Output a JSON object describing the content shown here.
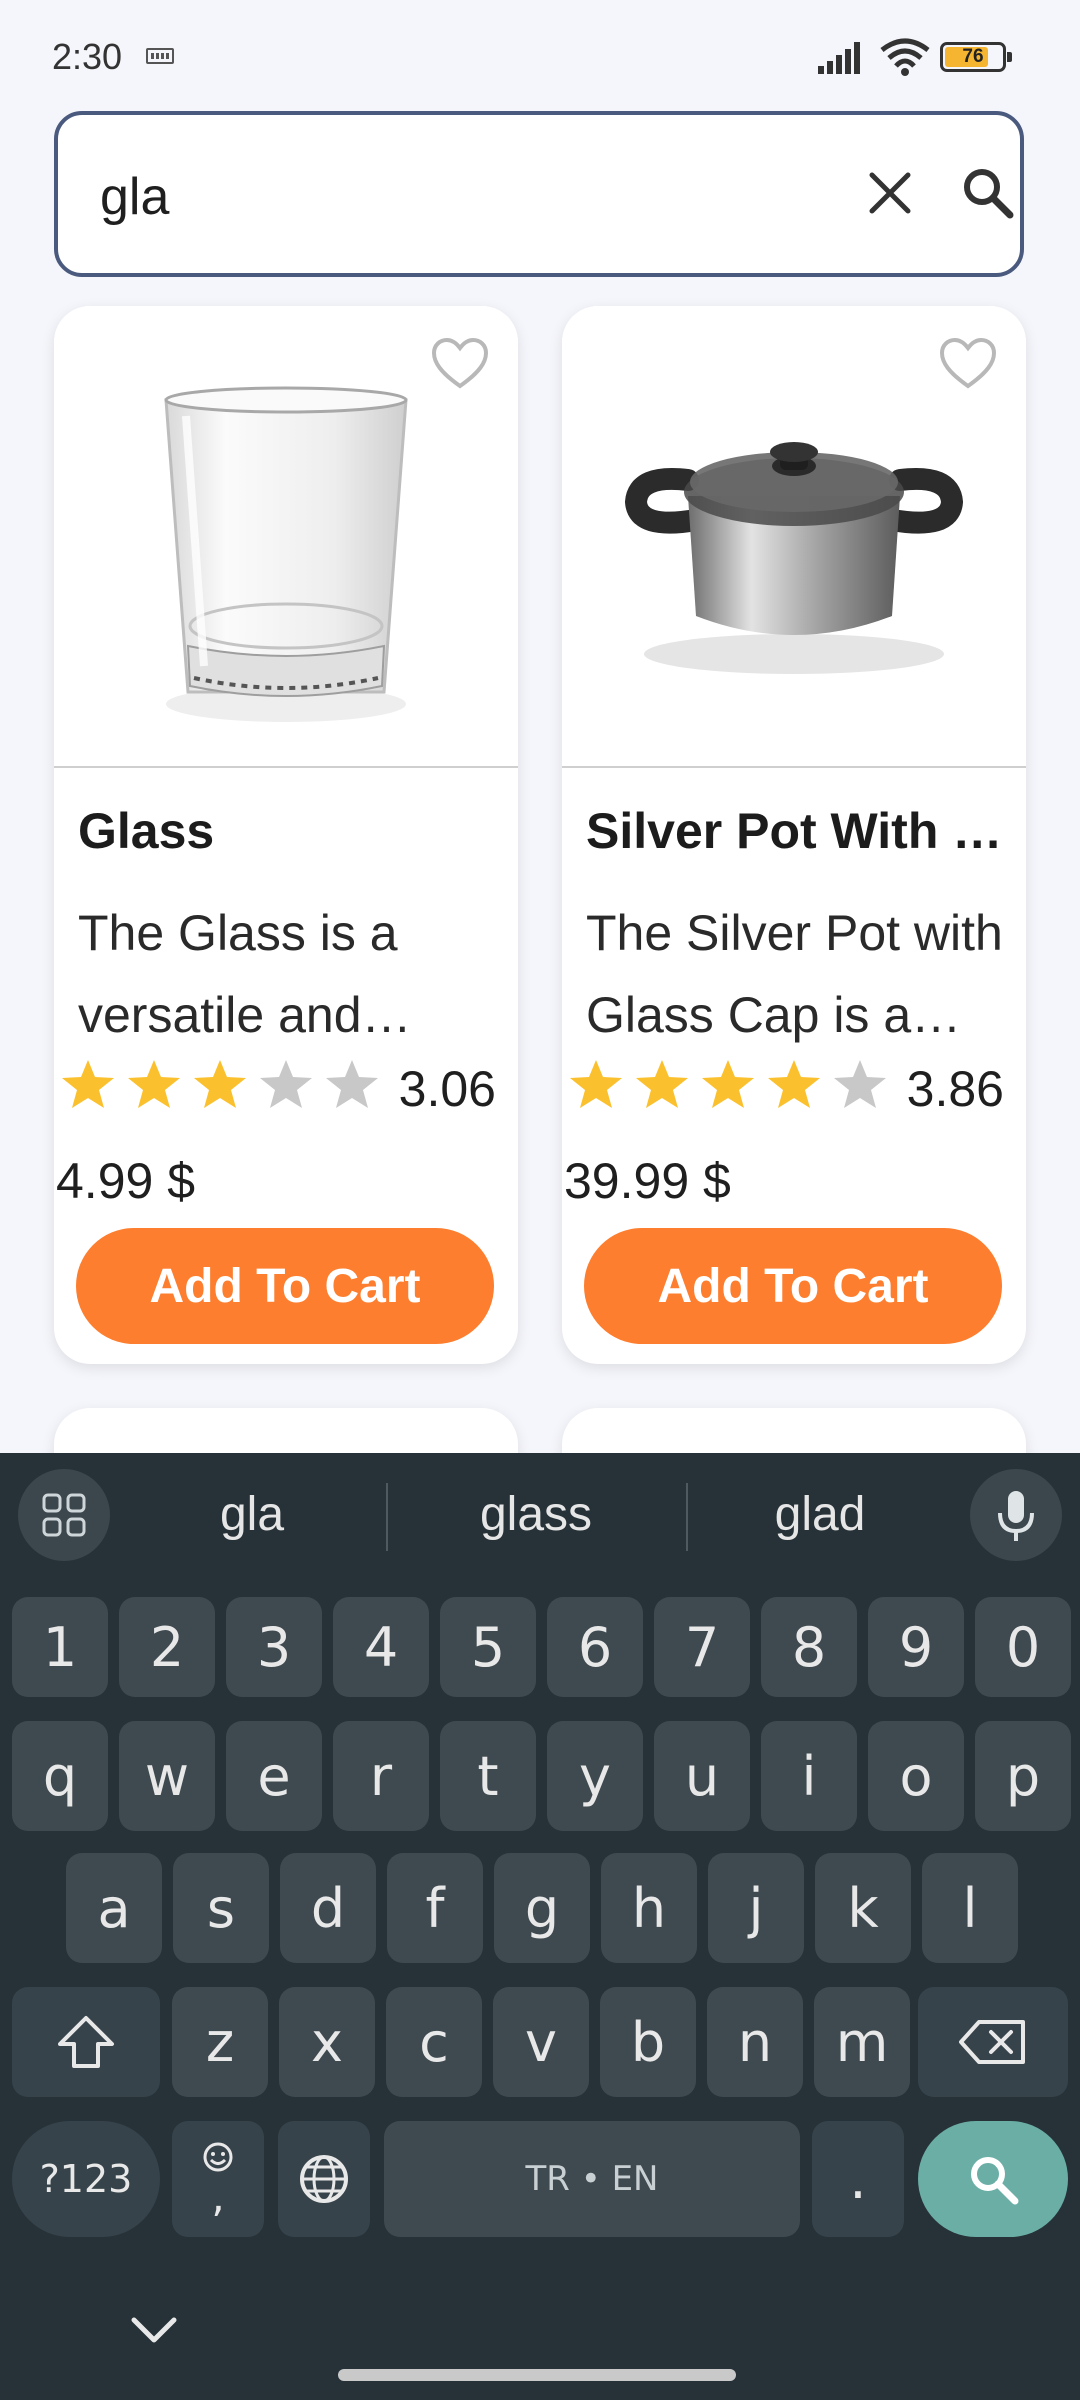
{
  "status_bar": {
    "time": "2:30",
    "battery": "76"
  },
  "search": {
    "value": "gla"
  },
  "products": [
    {
      "title": "Glass",
      "description": "The Glass is a versatile and elegant drinking vessel",
      "rating": 3.06,
      "rating_label": "3.06",
      "price": "4.99 $",
      "button": "Add To Cart"
    },
    {
      "title": "Silver Pot With Glass Cap",
      "description": "The Silver Pot with Glass Cap is a durable cookware",
      "rating": 3.86,
      "rating_label": "3.86",
      "price": "39.99 $",
      "button": "Add To Cart"
    }
  ],
  "keyboard": {
    "suggestions": [
      "gla",
      "glass",
      "glad"
    ],
    "number_row": [
      "1",
      "2",
      "3",
      "4",
      "5",
      "6",
      "7",
      "8",
      "9",
      "0"
    ],
    "row1": [
      "q",
      "w",
      "e",
      "r",
      "t",
      "y",
      "u",
      "i",
      "o",
      "p"
    ],
    "row2": [
      "a",
      "s",
      "d",
      "f",
      "g",
      "h",
      "j",
      "k",
      "l"
    ],
    "row3": [
      "z",
      "x",
      "c",
      "v",
      "b",
      "n",
      "m"
    ],
    "symbols_key": "?123",
    "emoji_comma_key": ",",
    "space_key": "TR • EN",
    "period_key": "."
  },
  "colors": {
    "accent": "#fd7e2e",
    "star": "#fbc02d",
    "star_empty": "#c8c8c8",
    "keyboard_bg": "#263238",
    "search_key": "#6aaea5"
  }
}
